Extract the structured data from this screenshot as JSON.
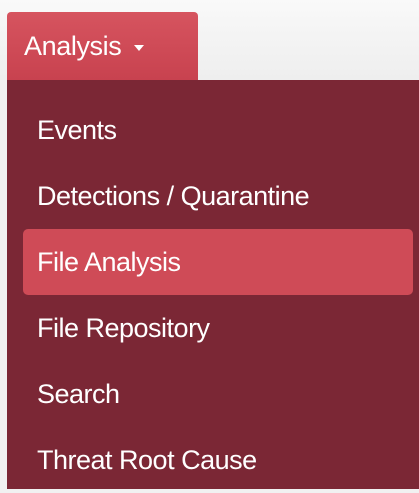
{
  "nav": {
    "toggle_label": "Analysis",
    "caret_icon": "caret-down-icon"
  },
  "menu": {
    "items": [
      {
        "label": "Events",
        "active": false
      },
      {
        "label": "Detections / Quarantine",
        "active": false
      },
      {
        "label": "File Analysis",
        "active": true
      },
      {
        "label": "File Repository",
        "active": false
      },
      {
        "label": "Search",
        "active": false
      },
      {
        "label": "Threat Root Cause",
        "active": false
      }
    ]
  },
  "colors": {
    "toggle_bg": "#d04c58",
    "menu_bg": "#7b2735",
    "active_item_bg": "#cf4b57",
    "text": "#ffffff",
    "page_bg": "#f1f1f1"
  }
}
